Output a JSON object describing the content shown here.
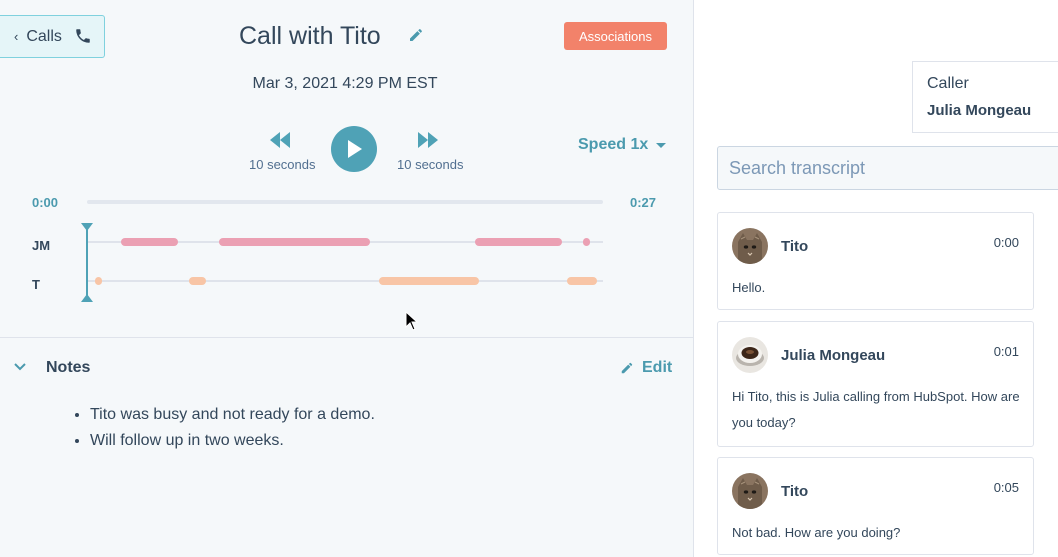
{
  "header": {
    "back_label": "Calls",
    "title": "Call with Tito",
    "associations_label": "Associations",
    "date": "Mar 3, 2021 4:29 PM EST"
  },
  "player": {
    "rewind_label": "10 seconds",
    "forward_label": "10 seconds",
    "speed_label": "Speed 1x",
    "time_start": "0:00",
    "time_end": "0:27",
    "playhead_position": 0.0,
    "lanes": [
      {
        "label": "JM",
        "speaker": "Julia Mongeau",
        "color": "#eba0b3",
        "segments": [
          [
            0.066,
            0.176
          ],
          [
            0.256,
            0.548
          ],
          [
            0.752,
            0.921
          ],
          [
            0.961,
            0.974
          ]
        ]
      },
      {
        "label": "T",
        "speaker": "Tito",
        "color": "#f8c5a6",
        "segments": [
          [
            0.016,
            0.029
          ],
          [
            0.198,
            0.231
          ],
          [
            0.566,
            0.76
          ],
          [
            0.93,
            0.988
          ]
        ]
      }
    ]
  },
  "notes": {
    "title": "Notes",
    "edit_label": "Edit",
    "items": [
      "Tito was busy and not ready for a demo.",
      "Will follow up in two weeks."
    ]
  },
  "caller": {
    "label": "Caller",
    "name": "Julia Mongeau"
  },
  "transcript": {
    "search_placeholder": "Search transcript",
    "entries": [
      {
        "name": "Tito",
        "time": "0:00",
        "text": "Hello.",
        "avatar": "cat-avatar"
      },
      {
        "name": "Julia Mongeau",
        "time": "0:01",
        "text": "Hi Tito, this is Julia calling from HubSpot. How are you today?",
        "avatar": "coffee-avatar"
      },
      {
        "name": "Tito",
        "time": "0:05",
        "text": "Not bad. How are you doing?",
        "avatar": "cat-avatar"
      }
    ]
  },
  "colors": {
    "accent": "#4fa2b6",
    "associations_button": "#f2826a",
    "jm_segment": "#eba0b3",
    "t_segment": "#f8c5a6"
  }
}
